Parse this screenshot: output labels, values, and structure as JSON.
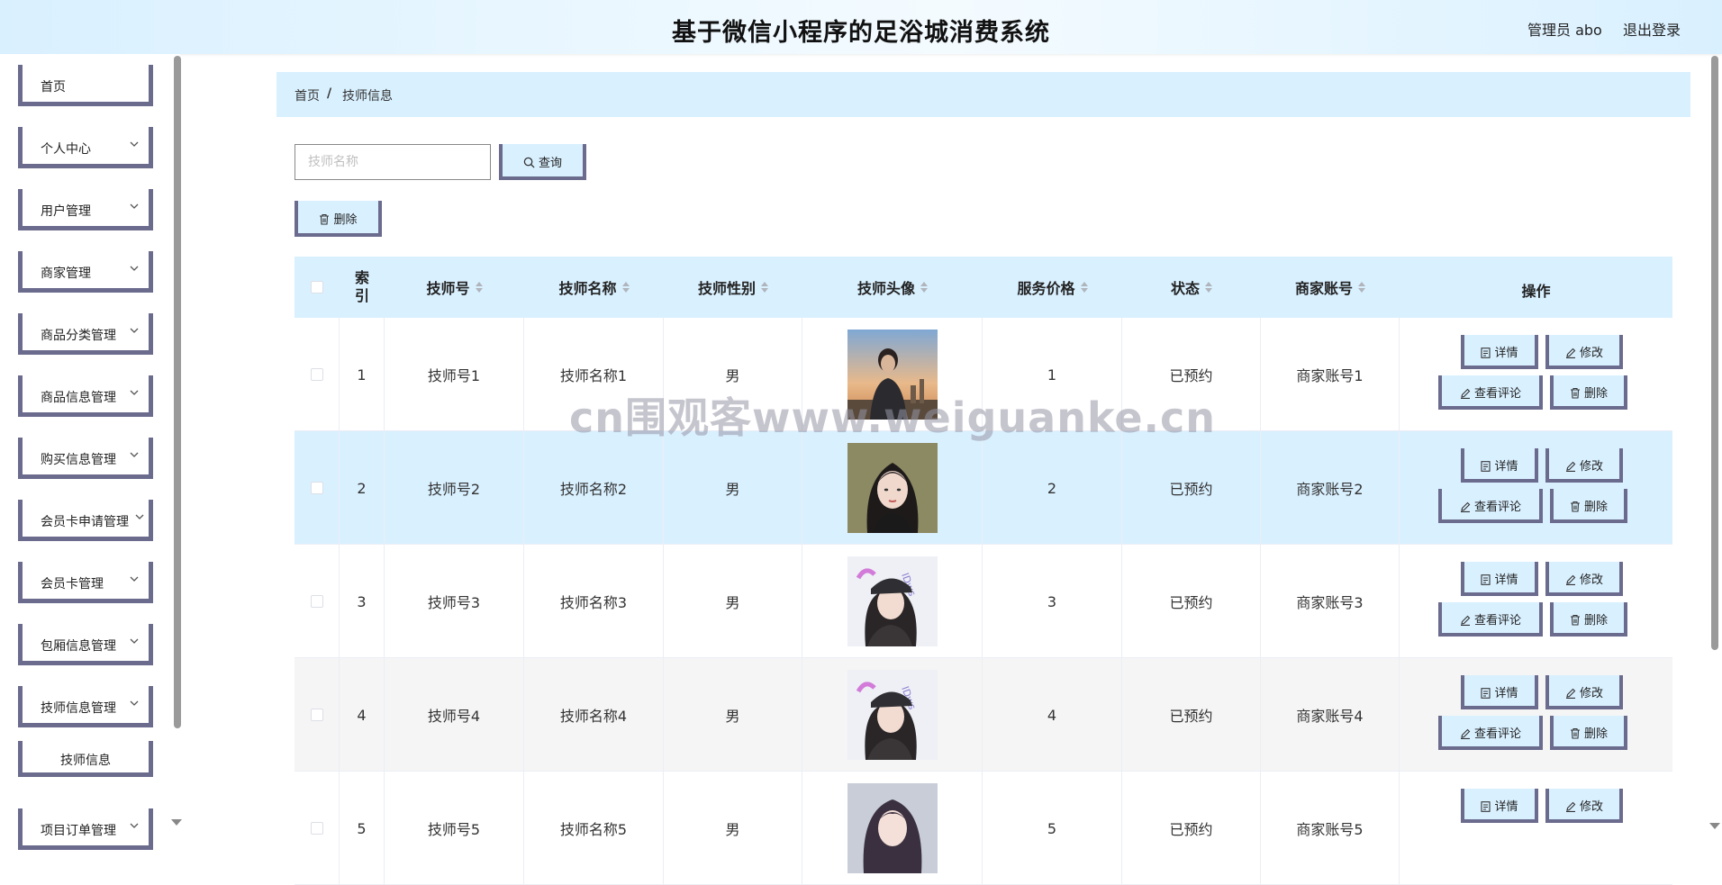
{
  "header": {
    "title": "基于微信小程序的足浴城消费系统",
    "admin": "管理员 abo",
    "logout": "退出登录"
  },
  "sidebar": {
    "items": [
      {
        "label": "首页"
      },
      {
        "label": "个人中心"
      },
      {
        "label": "用户管理"
      },
      {
        "label": "商家管理"
      },
      {
        "label": "商品分类管理"
      },
      {
        "label": "商品信息管理"
      },
      {
        "label": "购买信息管理"
      },
      {
        "label": "会员卡申请管理"
      },
      {
        "label": "会员卡管理"
      },
      {
        "label": "包厢信息管理"
      },
      {
        "label": "技师信息管理"
      },
      {
        "label": "项目订单管理"
      }
    ],
    "active_sub": "技师信息"
  },
  "breadcrumb": {
    "home": "首页",
    "sep": "/",
    "current": "技师信息"
  },
  "search": {
    "placeholder": "技师名称",
    "button": "查询"
  },
  "toolbar": {
    "delete": "删除"
  },
  "table": {
    "headers": [
      "索引",
      "技师号",
      "技师名称",
      "技师性别",
      "技师头像",
      "服务价格",
      "状态",
      "商家账号",
      "操作"
    ],
    "index_header_lines": [
      "索",
      "引"
    ],
    "rows": [
      {
        "index": "1",
        "no": "技师号1",
        "name": "技师名称1",
        "gender": "男",
        "price": "1",
        "status": "已预约",
        "merchant": "商家账号1",
        "avatar": "man-sunset"
      },
      {
        "index": "2",
        "no": "技师号2",
        "name": "技师名称2",
        "gender": "男",
        "price": "2",
        "status": "已预约",
        "merchant": "商家账号2",
        "avatar": "woman-dark-hair"
      },
      {
        "index": "3",
        "no": "技师号3",
        "name": "技师名称3",
        "gender": "男",
        "price": "3",
        "status": "已预约",
        "merchant": "商家账号3",
        "avatar": "woman-cap"
      },
      {
        "index": "4",
        "no": "技师号4",
        "name": "技师名称4",
        "gender": "男",
        "price": "4",
        "status": "已预约",
        "merchant": "商家账号4",
        "avatar": "woman-cap"
      },
      {
        "index": "5",
        "no": "技师号5",
        "name": "技师名称5",
        "gender": "男",
        "price": "5",
        "status": "已预约",
        "merchant": "商家账号5",
        "avatar": "woman-long-hair"
      }
    ],
    "actions": {
      "detail": "详情",
      "edit": "修改",
      "comments": "查看评论",
      "delete": "删除"
    }
  },
  "watermark": "cn围观客www.weiguanke.cn",
  "colors": {
    "accent_bg": "#d9f0ff",
    "button_border": "#6b6b8e",
    "row_highlight": "#d9f0ff",
    "row_stripe": "#f5f5f5"
  },
  "icons": [
    "chevron-down-icon",
    "search-icon",
    "trash-icon",
    "document-icon",
    "pencil-icon",
    "sort-icon"
  ]
}
